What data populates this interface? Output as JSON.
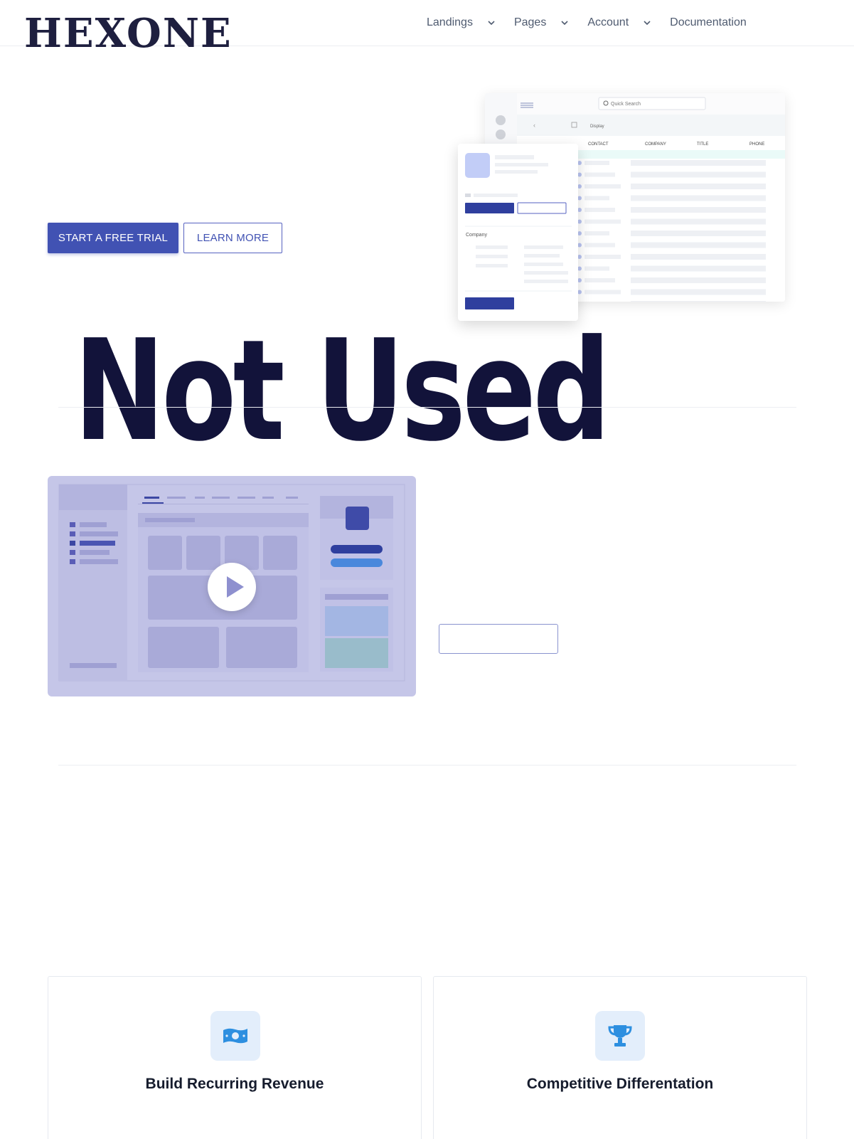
{
  "brand": {
    "logo_text": "HEXONE"
  },
  "nav": {
    "items": [
      {
        "label": "Landings"
      },
      {
        "label": "Pages"
      },
      {
        "label": "Account"
      },
      {
        "label": "Documentation"
      }
    ]
  },
  "hero": {
    "primary_cta": "START A FREE TRIAL",
    "secondary_cta": "LEARN MORE",
    "mockup": {
      "search_placeholder": "Quick Search",
      "display_label": "Display",
      "columns": [
        "CONTACT",
        "COMPANY",
        "TITLE",
        "PHONE"
      ],
      "card_section_label": "Company"
    }
  },
  "overlay_text": "Not Used",
  "features": [
    {
      "title": "Build Recurring Revenue",
      "icon": "money-bill-icon"
    },
    {
      "title": "Competitive Differentation",
      "icon": "trophy-icon"
    }
  ],
  "colors": {
    "primary": "#4152b3",
    "heading": "#12133a",
    "icon_blue": "#2d8fe0",
    "icon_bg": "#e3eefb",
    "video_bg": "#c5c6e8"
  }
}
